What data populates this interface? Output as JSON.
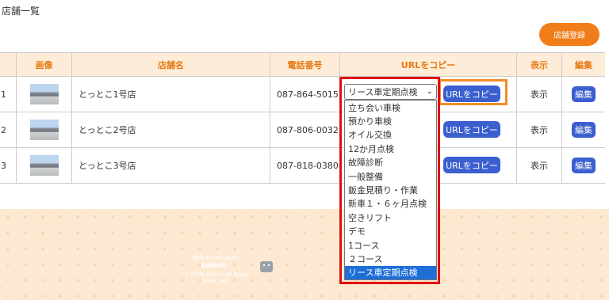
{
  "page": {
    "title": "店舗一覧",
    "register_label": "店舗登録"
  },
  "table": {
    "headers": {
      "image": "画像",
      "store_name": "店舗名",
      "phone": "電話番号",
      "url_copy": "URLをコピー",
      "display": "表示",
      "edit": "編集"
    },
    "rows": [
      {
        "num": "1",
        "name": "とっとこ1号店",
        "phone": "087-864-5015",
        "url_label": "URLをコピー",
        "display": "表示",
        "edit": "編集"
      },
      {
        "num": "2",
        "name": "とっとこ2号店",
        "phone": "087-806-0032",
        "url_label": "URLをコピー",
        "display": "表示",
        "edit": "編集"
      },
      {
        "num": "3",
        "name": "とっとこ3号店",
        "phone": "087-818-0380",
        "url_label": "URLをコピー",
        "display": "表示",
        "edit": "編集"
      }
    ]
  },
  "select": {
    "value": "リース車定期点検",
    "options": [
      "立ち会い車検",
      "預かり車検",
      "オイル交換",
      "12か月点検",
      "故障診断",
      "一般整備",
      "鈑金見積り・作業",
      "新車１・６ヶ月点検",
      "空きリフト",
      "デモ",
      "1コース",
      "２コース",
      "リース車定期点検"
    ]
  },
  "footer": {
    "line1": "Web Reservation system",
    "brand": "totoco",
    "copyright": "©2016 totoco All Right Reserved."
  },
  "colors": {
    "accent": "#f07d1a",
    "button_blue": "#3b5fcf",
    "highlight_red": "#e01010",
    "highlight_orange": "#f28c28"
  }
}
